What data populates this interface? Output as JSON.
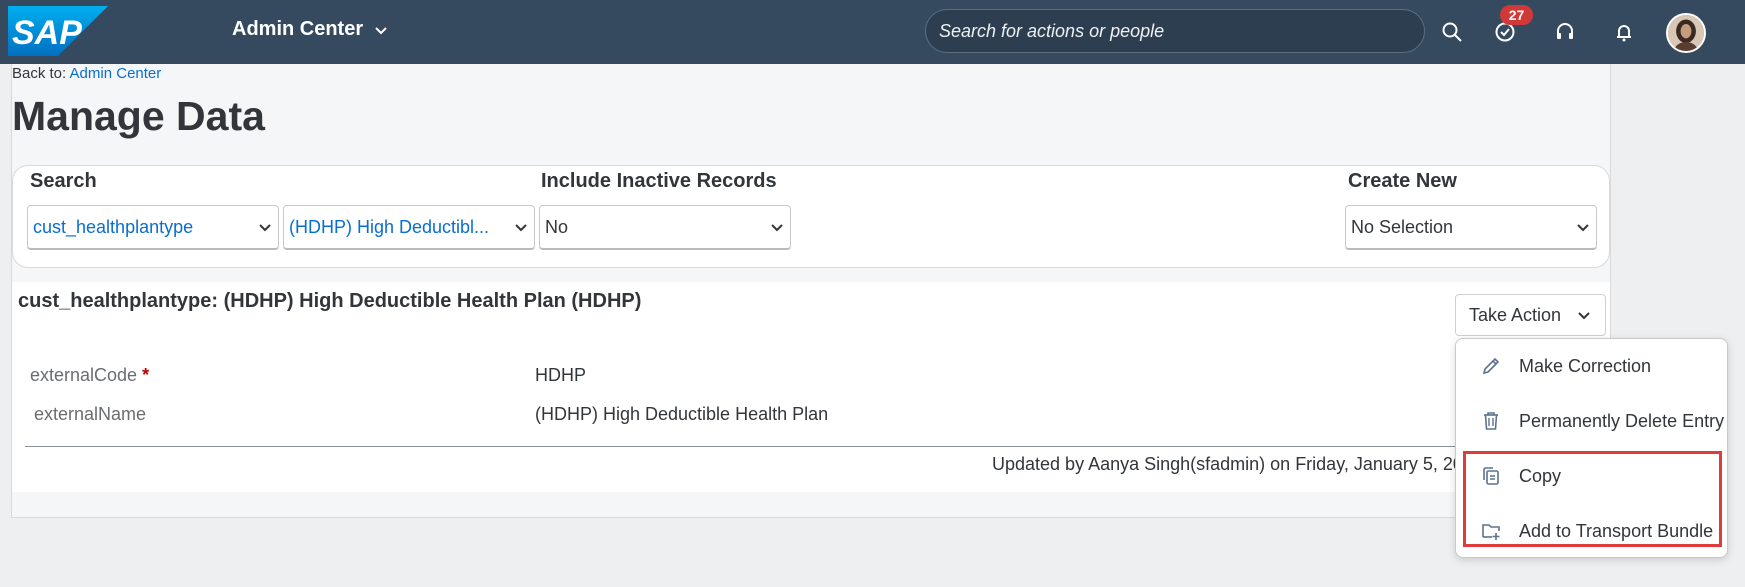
{
  "shell": {
    "logo_text": "SAP",
    "app_title": "Admin Center",
    "search_placeholder": "Search for actions or people",
    "notification_count": "27"
  },
  "breadcrumb": {
    "prefix": "Back to:",
    "link": "Admin Center"
  },
  "page_title": "Manage Data",
  "search_panel": {
    "search_label": "Search",
    "object_type": "cust_healthplantype",
    "object_instance": "(HDHP) High Deductibl...",
    "inactive_label": "Include Inactive Records",
    "inactive_value": "No",
    "create_label": "Create New",
    "create_value": "No Selection"
  },
  "record": {
    "title": "cust_healthplantype: (HDHP) High Deductible Health Plan (HDHP)",
    "take_action_label": "Take Action",
    "fields": [
      {
        "label": "externalCode",
        "required": "*",
        "value": "HDHP"
      },
      {
        "label": "externalName",
        "value": "(HDHP) High Deductible Health Plan"
      }
    ],
    "updated_text": "Updated by Aanya Singh(sfadmin) on Friday, January 5, 2024"
  },
  "action_menu": {
    "items": [
      {
        "label": "Make Correction",
        "icon": "pencil-icon"
      },
      {
        "label": "Permanently Delete Entry",
        "icon": "trash-icon"
      },
      {
        "label": "Copy",
        "icon": "copy-icon"
      },
      {
        "label": "Add to Transport Bundle",
        "icon": "folder-add-icon"
      }
    ]
  },
  "colors": {
    "shell_bg": "#354a5f",
    "link": "#0a6ed1",
    "badge": "#d13938",
    "highlight_box": "#e03b3b"
  }
}
